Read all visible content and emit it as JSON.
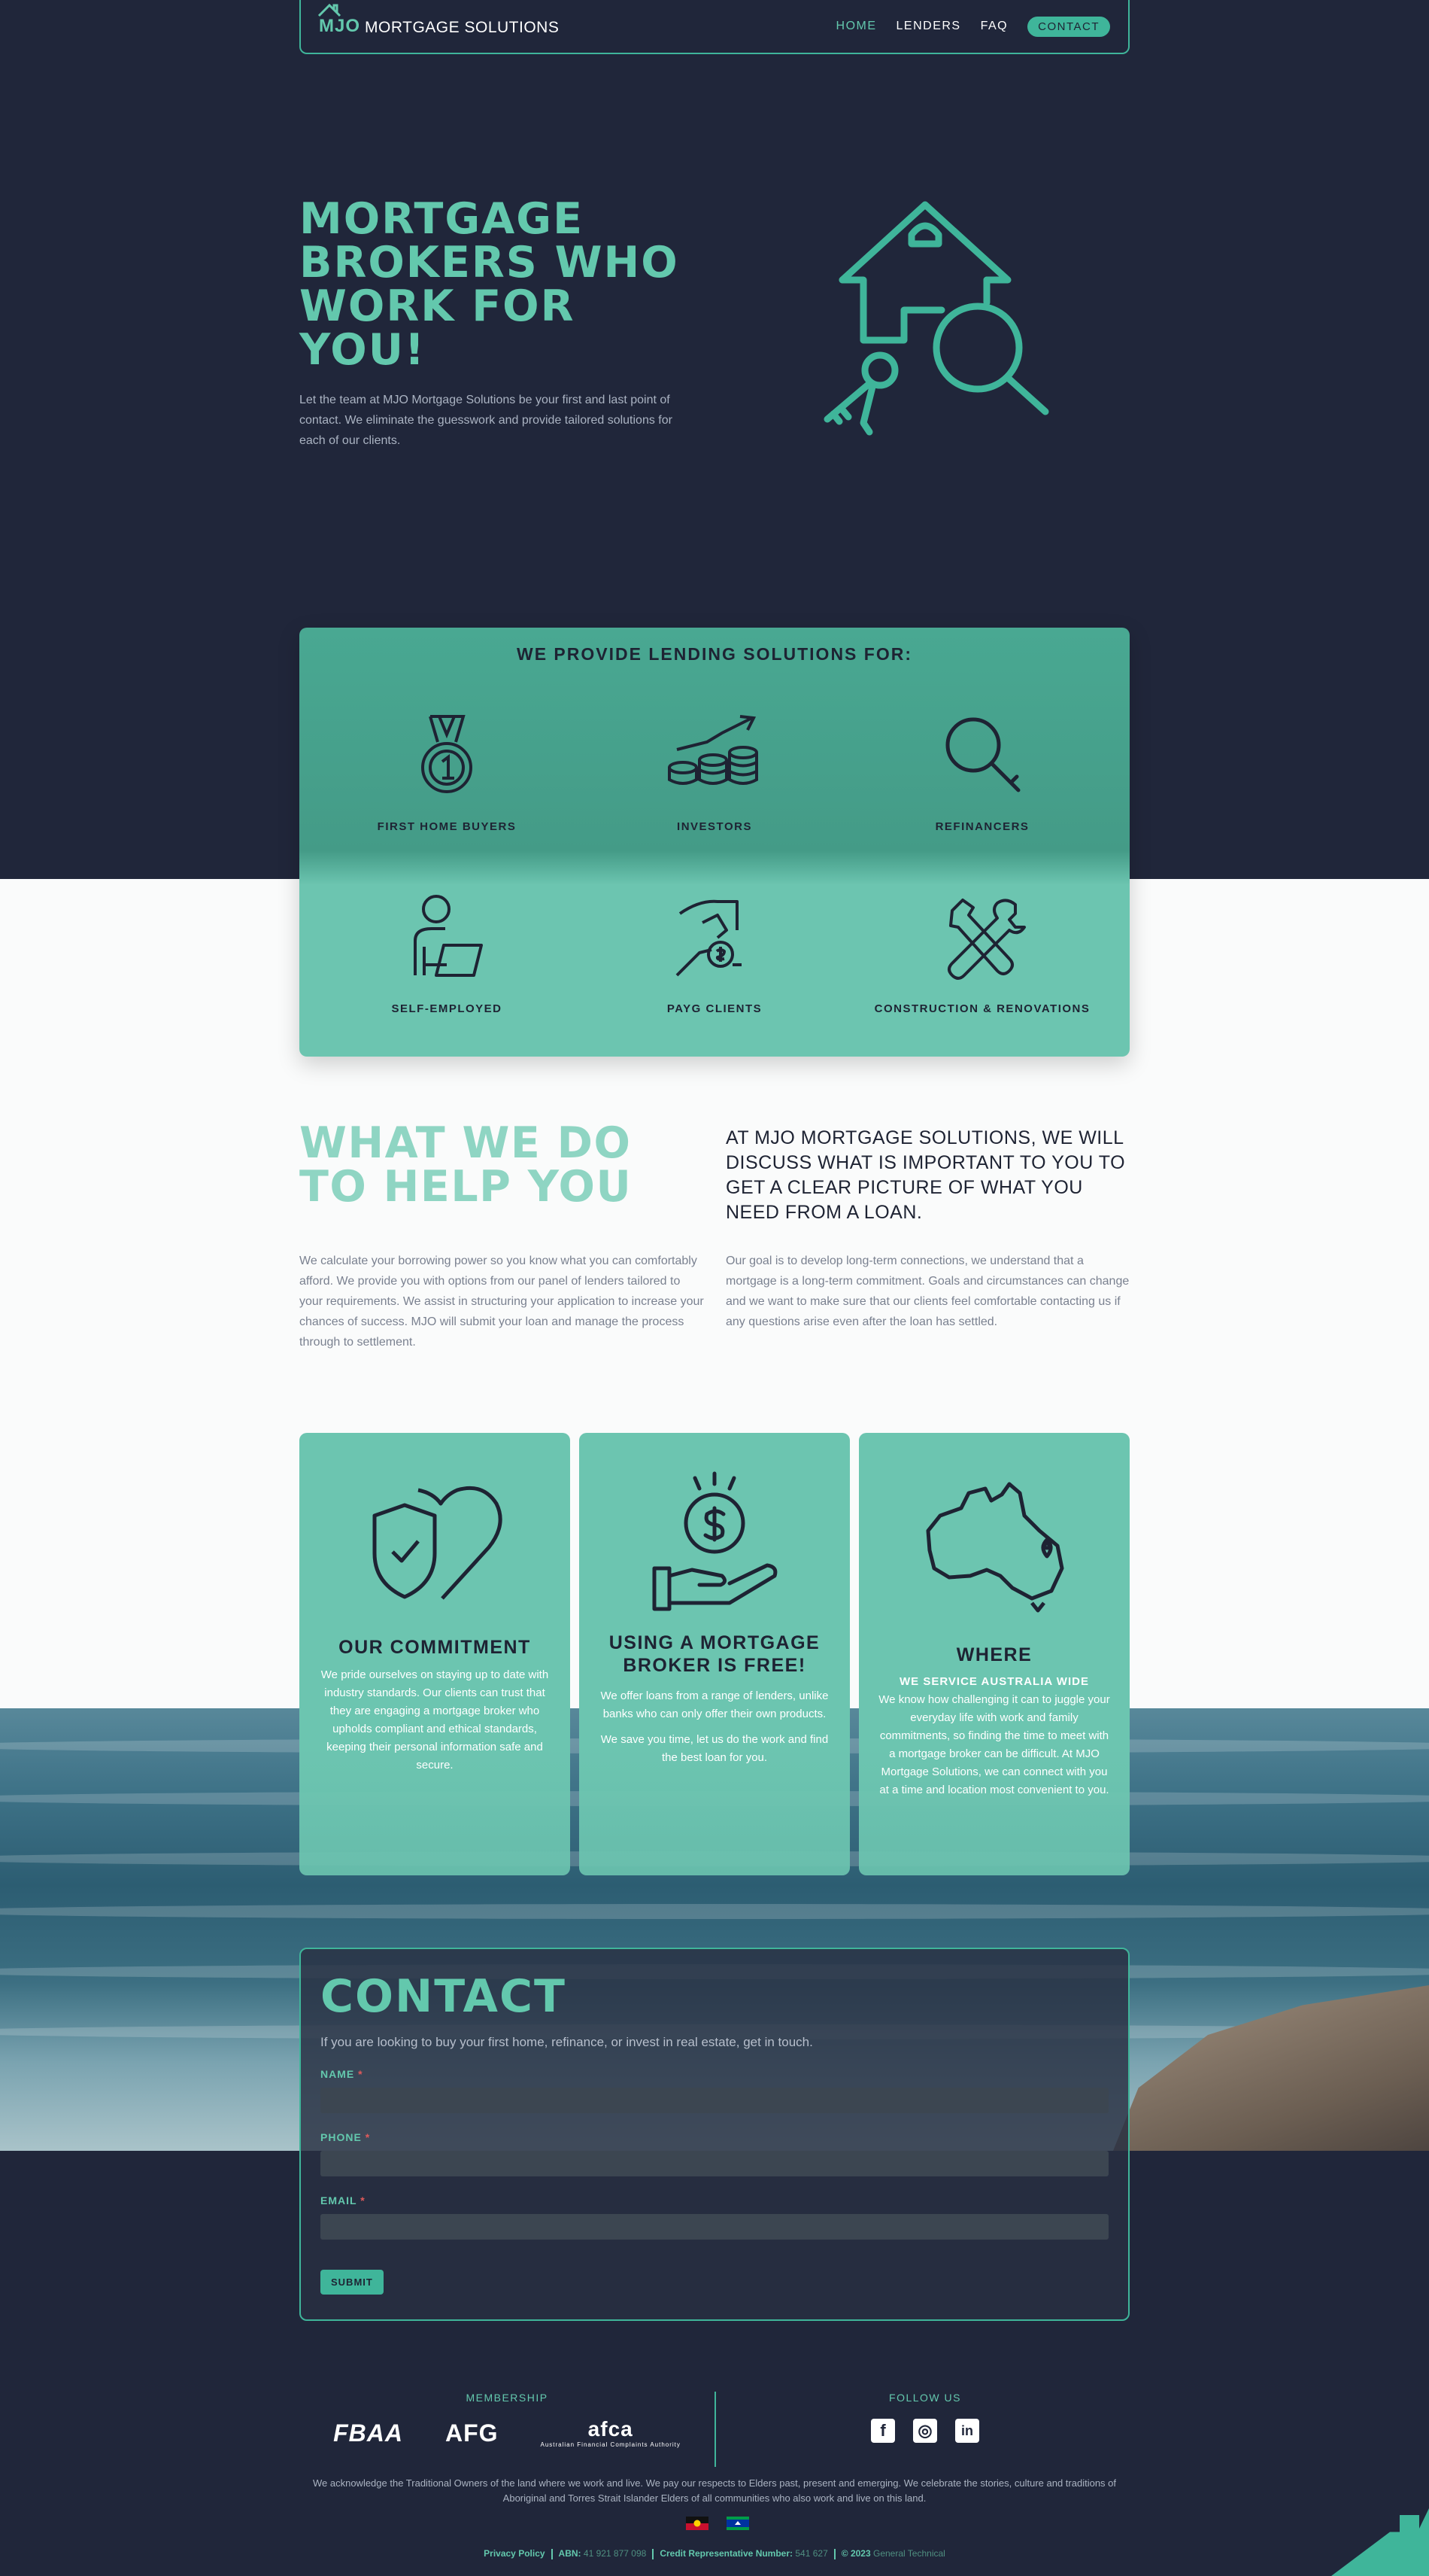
{
  "nav": {
    "logo_mark": "MJO",
    "logo_text": "MORTGAGE SOLUTIONS",
    "links": [
      "HOME",
      "LENDERS",
      "FAQ"
    ],
    "cta": "CONTACT"
  },
  "hero": {
    "title": "MORTGAGE BROKERS WHO WORK FOR YOU!",
    "description": "Let the team at MJO Mortgage Solutions be your first and last point of contact. We eliminate the guesswork and provide tailored solutions for each of our clients.",
    "illustration": "house-key-magnifier-icon"
  },
  "lending": {
    "title": "WE PROVIDE LENDING SOLUTIONS FOR:",
    "items": [
      {
        "label": "FIRST HOME BUYERS",
        "icon": "medal-icon"
      },
      {
        "label": "INVESTORS",
        "icon": "coins-growth-icon"
      },
      {
        "label": "REFINANCERS",
        "icon": "magnifier-icon"
      },
      {
        "label": "SELF-EMPLOYED",
        "icon": "person-laptop-icon"
      },
      {
        "label": "PAYG CLIENTS",
        "icon": "hand-money-icon"
      },
      {
        "label": "CONSTRUCTION & RENOVATIONS",
        "icon": "tools-icon"
      }
    ]
  },
  "what": {
    "title": "WHAT WE DO TO HELP YOU",
    "lead": "AT MJO MORTGAGE SOLUTIONS, WE WILL DISCUSS WHAT IS IMPORTANT TO YOU TO GET A CLEAR PICTURE OF WHAT YOU NEED FROM A LOAN.",
    "left": "We calculate your borrowing power so you know what you can comfortably afford. We provide you with options from our panel of lenders tailored to your requirements. We assist in structuring your application to increase your chances of success. MJO will submit your loan and manage the process through to settlement.",
    "right": "Our goal is to develop long-term connections, we understand that a mortgage is a long-term commitment. Goals and circumstances can change and we want to make sure that our clients feel comfortable contacting us if any questions arise even after the loan has settled."
  },
  "cards": [
    {
      "title": "OUR COMMITMENT",
      "icon": "heart-shield-icon",
      "text": "We pride ourselves on staying up to date with industry standards. Our clients can trust that they are engaging a mortgage broker who upholds compliant and ethical standards, keeping their personal information safe and secure."
    },
    {
      "title": "USING A MORTGAGE BROKER IS FREE!",
      "icon": "hand-dollar-icon",
      "text": "We offer loans from a range of lenders, unlike banks who can only offer their own products.",
      "text2": "We save you time, let us do the work and find the best loan for you."
    },
    {
      "title": "WHERE",
      "icon": "australia-map-icon",
      "subtitle": "WE SERVICE AUSTRALIA WIDE",
      "text": "We know how challenging it can to juggle your everyday life with work and family commitments, so finding the time to meet with a mortgage broker can be difficult. At MJO Mortgage Solutions, we can connect with you at a time and location most convenient to you."
    }
  ],
  "contact": {
    "title": "CONTACT",
    "intro": "If you are looking to buy your first home, refinance, or invest in real estate, get in touch.",
    "fields": [
      {
        "label": "NAME",
        "required": "*",
        "value": ""
      },
      {
        "label": "PHONE",
        "required": "*",
        "value": ""
      },
      {
        "label": "EMAIL",
        "required": "*",
        "value": ""
      }
    ],
    "submit": "SUBMIT"
  },
  "footer": {
    "membership_head": "MEMBERSHIP",
    "memberships": [
      "FBAA",
      "AFG",
      "afca"
    ],
    "afca_sub": "Australian Financial Complaints Authority",
    "follow_head": "FOLLOW US",
    "social": [
      {
        "name": "facebook",
        "icon": "facebook-icon",
        "glyph": "f"
      },
      {
        "name": "instagram",
        "icon": "instagram-icon",
        "glyph": "◎"
      },
      {
        "name": "linkedin",
        "icon": "linkedin-icon",
        "glyph": "in"
      }
    ],
    "acknowledgement": "We acknowledge the Traditional Owners of the land where we work and live. We pay our respects to Elders past, present and emerging. We celebrate the stories, culture and traditions of Aboriginal and Torres Strait Islander Elders of all communities who also work and live on this land.",
    "flags": [
      "aboriginal-flag-icon",
      "torres-strait-flag-icon"
    ],
    "legal": {
      "privacy": "Privacy Policy",
      "abn_label": "ABN:",
      "abn_value": "41 921 877 098",
      "crn_label": "Credit Representative Number:",
      "crn_value": "541 627",
      "copyright": "© 2023",
      "credit": "General Technical"
    }
  },
  "colors": {
    "navy": "#20263a",
    "teal": "#3fb59a",
    "teal_light": "#6cc5b0",
    "mint_text": "#63c8ad"
  }
}
